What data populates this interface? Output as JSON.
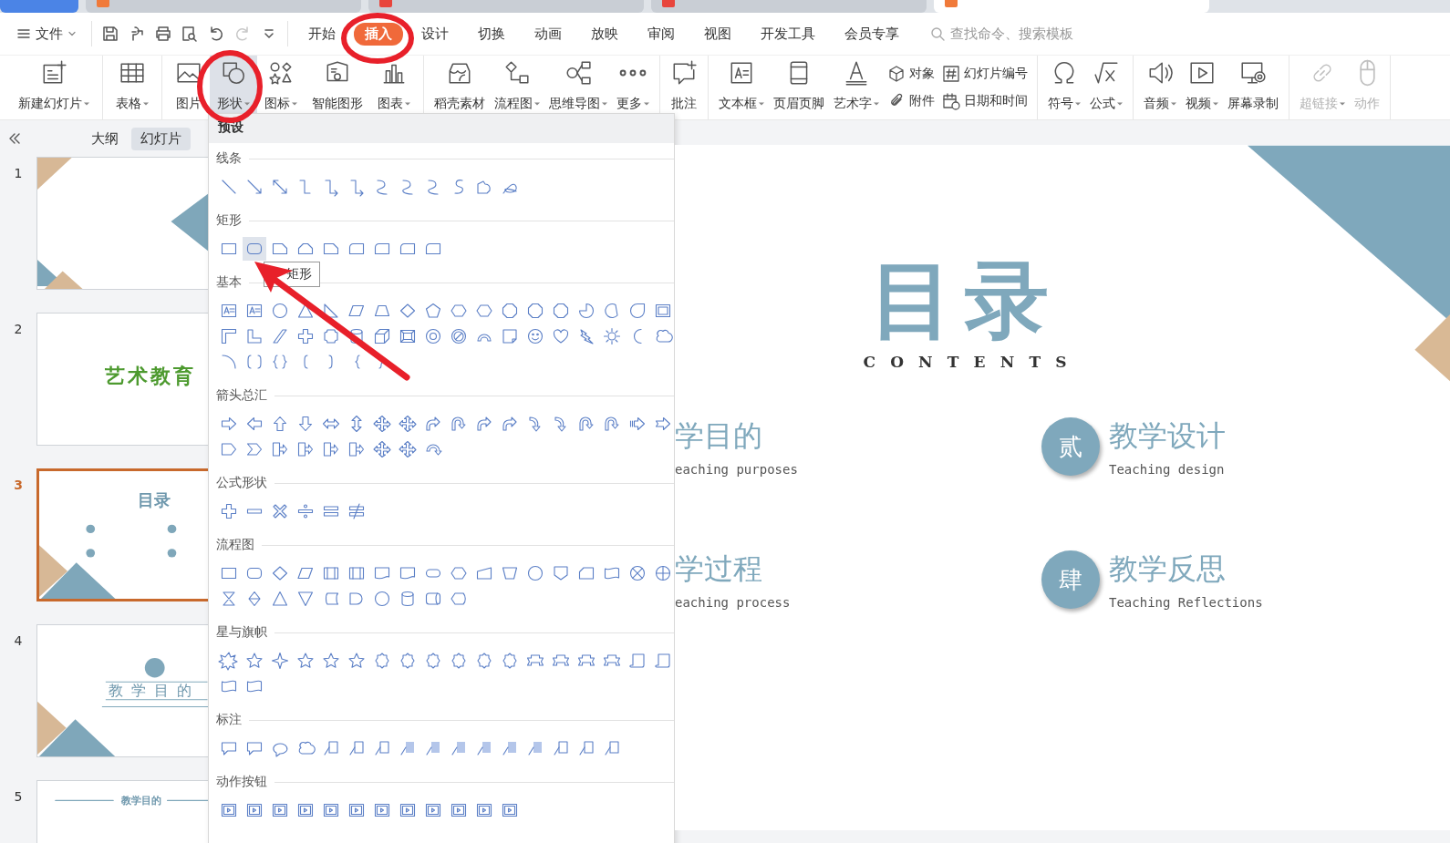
{
  "doc_tabs": [
    {
      "kind": "home",
      "selected": false
    },
    {
      "kind": "doc",
      "selected": false,
      "color": "#f07a3a"
    },
    {
      "kind": "doc",
      "selected": false,
      "color": "#e8453c"
    },
    {
      "kind": "doc",
      "selected": false,
      "color": "#e8453c"
    },
    {
      "kind": "doc",
      "selected": true,
      "color": "#f07a3a"
    }
  ],
  "menu": {
    "file": "文件",
    "tabs": [
      {
        "label": "开始",
        "selected": false
      },
      {
        "label": "插入",
        "selected": true
      },
      {
        "label": "设计",
        "selected": false
      },
      {
        "label": "切换",
        "selected": false
      },
      {
        "label": "动画",
        "selected": false
      },
      {
        "label": "放映",
        "selected": false
      },
      {
        "label": "审阅",
        "selected": false
      },
      {
        "label": "视图",
        "selected": false
      },
      {
        "label": "开发工具",
        "selected": false
      },
      {
        "label": "会员专享",
        "selected": false
      }
    ],
    "search": {
      "placeholder": "查找命令、搜索模板"
    }
  },
  "ribbon": [
    {
      "items": [
        {
          "kind": "large",
          "label": "新建幻灯片",
          "dropdown": true,
          "selected": false,
          "disabled": false
        }
      ]
    },
    {
      "items": [
        {
          "kind": "large",
          "label": "表格",
          "dropdown": true,
          "selected": false,
          "disabled": false
        }
      ]
    },
    {
      "items": [
        {
          "kind": "large",
          "label": "图片",
          "dropdown": false,
          "selected": false,
          "disabled": false
        },
        {
          "kind": "large",
          "label": "形状",
          "dropdown": true,
          "selected": true,
          "disabled": false
        },
        {
          "kind": "large",
          "label": "图标",
          "dropdown": true,
          "selected": false,
          "disabled": false
        },
        {
          "kind": "large",
          "label": "智能图形",
          "dropdown": false,
          "selected": false,
          "disabled": false
        },
        {
          "kind": "large",
          "label": "图表",
          "dropdown": true,
          "selected": false,
          "disabled": false
        }
      ]
    },
    {
      "items": [
        {
          "kind": "large",
          "label": "稻壳素材",
          "dropdown": false,
          "selected": false,
          "disabled": false
        },
        {
          "kind": "large",
          "label": "流程图",
          "dropdown": true,
          "selected": false,
          "disabled": false
        },
        {
          "kind": "large",
          "label": "思维导图",
          "dropdown": true,
          "selected": false,
          "disabled": false
        },
        {
          "kind": "large",
          "label": "更多",
          "dropdown": true,
          "selected": false,
          "disabled": false
        }
      ]
    },
    {
      "items": [
        {
          "kind": "large",
          "label": "批注",
          "dropdown": false,
          "selected": false,
          "disabled": false
        }
      ]
    },
    {
      "items": [
        {
          "kind": "large",
          "label": "文本框",
          "dropdown": true,
          "selected": false,
          "disabled": false
        },
        {
          "kind": "large",
          "label": "页眉页脚",
          "dropdown": false,
          "selected": false,
          "disabled": false
        },
        {
          "kind": "large",
          "label": "艺术字",
          "dropdown": true,
          "selected": false,
          "disabled": false
        },
        {
          "kind": "stack",
          "items": [
            {
              "label": "对象"
            },
            {
              "label": "附件"
            }
          ]
        },
        {
          "kind": "stack",
          "items": [
            {
              "label": "幻灯片编号"
            },
            {
              "label": "日期和时间"
            }
          ]
        }
      ]
    },
    {
      "items": [
        {
          "kind": "large",
          "label": "符号",
          "dropdown": true,
          "selected": false,
          "disabled": false
        },
        {
          "kind": "large",
          "label": "公式",
          "dropdown": true,
          "selected": false,
          "disabled": false
        }
      ]
    },
    {
      "items": [
        {
          "kind": "large",
          "label": "音频",
          "dropdown": true,
          "selected": false,
          "disabled": false
        },
        {
          "kind": "large",
          "label": "视频",
          "dropdown": true,
          "selected": false,
          "disabled": false
        },
        {
          "kind": "large",
          "label": "屏幕录制",
          "dropdown": false,
          "selected": false,
          "disabled": false
        }
      ]
    },
    {
      "items": [
        {
          "kind": "large",
          "label": "超链接",
          "dropdown": true,
          "selected": false,
          "disabled": true
        },
        {
          "kind": "large",
          "label": "动作",
          "dropdown": false,
          "selected": false,
          "disabled": true
        }
      ]
    }
  ],
  "sidebar": {
    "tabs": [
      {
        "label": "大纲",
        "selected": false
      },
      {
        "label": "幻灯片",
        "selected": true
      }
    ],
    "slides": [
      {
        "number": "1",
        "kind": "cover",
        "selected": false
      },
      {
        "number": "2",
        "kind": "title",
        "text": "艺术教育",
        "selected": false
      },
      {
        "number": "3",
        "kind": "contents",
        "text": "目录",
        "selected": true
      },
      {
        "number": "4",
        "kind": "section",
        "text": "教 学 目 的",
        "selected": false
      },
      {
        "number": "5",
        "kind": "content",
        "text": "教学目的",
        "selected": false
      }
    ]
  },
  "shapes_menu": {
    "header": "预设",
    "tooltip": "矩形",
    "sections": [
      {
        "title": "线条",
        "shapes": [
          {
            "kind": "line",
            "hovered": false
          },
          {
            "kind": "arrowline",
            "hovered": false
          },
          {
            "kind": "dblline",
            "hovered": false
          },
          {
            "kind": "elbow",
            "hovered": false
          },
          {
            "kind": "elbowarrow",
            "hovered": false
          },
          {
            "kind": "elbowarrow",
            "hovered": false
          },
          {
            "kind": "curve",
            "hovered": false
          },
          {
            "kind": "curve",
            "hovered": false
          },
          {
            "kind": "curve",
            "hovered": false
          },
          {
            "kind": "scurve",
            "hovered": false
          },
          {
            "kind": "freeform",
            "hovered": false
          },
          {
            "kind": "scribble",
            "hovered": false
          }
        ]
      },
      {
        "title": "矩形",
        "shapes": [
          {
            "kind": "rect",
            "hovered": false
          },
          {
            "kind": "rrect",
            "hovered": true
          },
          {
            "kind": "snip",
            "hovered": false
          },
          {
            "kind": "snip2",
            "hovered": false
          },
          {
            "kind": "snip",
            "hovered": false
          },
          {
            "kind": "roundtop",
            "hovered": false
          },
          {
            "kind": "roundtop",
            "hovered": false
          },
          {
            "kind": "roundtop",
            "hovered": false
          },
          {
            "kind": "roundtop",
            "hovered": false
          }
        ]
      },
      {
        "title": "基本",
        "shapes": [
          {
            "kind": "textbox",
            "hovered": false
          },
          {
            "kind": "textbox",
            "hovered": false
          },
          {
            "kind": "circle",
            "hovered": false
          },
          {
            "kind": "tri",
            "hovered": false
          },
          {
            "kind": "rtri",
            "hovered": false
          },
          {
            "kind": "para",
            "hovered": false
          },
          {
            "kind": "trap",
            "hovered": false
          },
          {
            "kind": "diamond",
            "hovered": false
          },
          {
            "kind": "pent",
            "hovered": false
          },
          {
            "kind": "hex",
            "hovered": false
          },
          {
            "kind": "hex",
            "hovered": false
          },
          {
            "kind": "oct",
            "hovered": false
          },
          {
            "kind": "oct",
            "hovered": false
          },
          {
            "kind": "oct",
            "hovered": false
          },
          {
            "kind": "pie",
            "hovered": false
          },
          {
            "kind": "chord",
            "hovered": false
          },
          {
            "kind": "tear",
            "hovered": false
          },
          {
            "kind": "frame",
            "hovered": false
          },
          {
            "kind": "corner",
            "hovered": false
          },
          {
            "kind": "lshape",
            "hovered": false
          },
          {
            "kind": "diag",
            "hovered": false
          },
          {
            "kind": "plus",
            "hovered": false
          },
          {
            "kind": "plaque",
            "hovered": false
          },
          {
            "kind": "can",
            "hovered": false
          },
          {
            "kind": "cube",
            "hovered": false
          },
          {
            "kind": "bevel",
            "hovered": false
          },
          {
            "kind": "donut",
            "hovered": false
          },
          {
            "kind": "nosym",
            "hovered": false
          },
          {
            "kind": "arc",
            "hovered": false
          },
          {
            "kind": "fold",
            "hovered": false
          },
          {
            "kind": "smile",
            "hovered": false
          },
          {
            "kind": "heart",
            "hovered": false
          },
          {
            "kind": "bolt",
            "hovered": false
          },
          {
            "kind": "sun",
            "hovered": false
          },
          {
            "kind": "moon",
            "hovered": false
          },
          {
            "kind": "cloud",
            "hovered": false
          },
          {
            "kind": "quarc",
            "hovered": false
          },
          {
            "kind": "bracketpair",
            "hovered": false
          },
          {
            "kind": "bracepair",
            "hovered": false
          },
          {
            "kind": "lbracket",
            "hovered": false
          },
          {
            "kind": "rbracket",
            "hovered": false
          },
          {
            "kind": "lbrace",
            "hovered": false
          },
          {
            "kind": "rbrace",
            "hovered": false
          }
        ]
      },
      {
        "title": "箭头总汇",
        "shapes": [
          {
            "kind": "rarrow",
            "hovered": false
          },
          {
            "kind": "larrow",
            "hovered": false
          },
          {
            "kind": "uarrow",
            "hovered": false
          },
          {
            "kind": "darrow",
            "hovered": false
          },
          {
            "kind": "lrarrow",
            "hovered": false
          },
          {
            "kind": "udarrow",
            "hovered": false
          },
          {
            "kind": "quadarrow",
            "hovered": false
          },
          {
            "kind": "quadarrow",
            "hovered": false
          },
          {
            "kind": "bent",
            "hovered": false
          },
          {
            "kind": "uturn",
            "hovered": false
          },
          {
            "kind": "bent",
            "hovered": false
          },
          {
            "kind": "bent",
            "hovered": false
          },
          {
            "kind": "curvedarrow",
            "hovered": false
          },
          {
            "kind": "curvedarrow",
            "hovered": false
          },
          {
            "kind": "uturn",
            "hovered": false
          },
          {
            "kind": "uturn",
            "hovered": false
          },
          {
            "kind": "striped",
            "hovered": false
          },
          {
            "kind": "notched",
            "hovered": false
          },
          {
            "kind": "pentarrow",
            "hovered": false
          },
          {
            "kind": "chevron",
            "hovered": false
          },
          {
            "kind": "calloutarrow",
            "hovered": false
          },
          {
            "kind": "calloutarrow",
            "hovered": false
          },
          {
            "kind": "calloutarrow",
            "hovered": false
          },
          {
            "kind": "calloutarrow",
            "hovered": false
          },
          {
            "kind": "quadarrow",
            "hovered": false
          },
          {
            "kind": "quadarrow",
            "hovered": false
          },
          {
            "kind": "circarrow",
            "hovered": false
          }
        ]
      },
      {
        "title": "公式形状",
        "shapes": [
          {
            "kind": "plus",
            "hovered": false
          },
          {
            "kind": "minus",
            "hovered": false
          },
          {
            "kind": "times",
            "hovered": false
          },
          {
            "kind": "divide",
            "hovered": false
          },
          {
            "kind": "equal",
            "hovered": false
          },
          {
            "kind": "neq",
            "hovered": false
          }
        ]
      },
      {
        "title": "流程图",
        "shapes": [
          {
            "kind": "rect",
            "hovered": false
          },
          {
            "kind": "rrect",
            "hovered": false
          },
          {
            "kind": "diamond",
            "hovered": false
          },
          {
            "kind": "para",
            "hovered": false
          },
          {
            "kind": "predef",
            "hovered": false
          },
          {
            "kind": "predef",
            "hovered": false
          },
          {
            "kind": "doc",
            "hovered": false
          },
          {
            "kind": "doc",
            "hovered": false
          },
          {
            "kind": "terminator",
            "hovered": false
          },
          {
            "kind": "hex",
            "hovered": false
          },
          {
            "kind": "manual",
            "hovered": false
          },
          {
            "kind": "invtrap",
            "hovered": false
          },
          {
            "kind": "circle",
            "hovered": false
          },
          {
            "kind": "offpage",
            "hovered": false
          },
          {
            "kind": "card",
            "hovered": false
          },
          {
            "kind": "tape",
            "hovered": false
          },
          {
            "kind": "xcircle",
            "hovered": false
          },
          {
            "kind": "pluscircle",
            "hovered": false
          },
          {
            "kind": "hourglass",
            "hovered": false
          },
          {
            "kind": "sort",
            "hovered": false
          },
          {
            "kind": "tri",
            "hovered": false
          },
          {
            "kind": "invtri",
            "hovered": false
          },
          {
            "kind": "stored",
            "hovered": false
          },
          {
            "kind": "delay",
            "hovered": false
          },
          {
            "kind": "circle",
            "hovered": false
          },
          {
            "kind": "can",
            "hovered": false
          },
          {
            "kind": "hcan",
            "hovered": false
          },
          {
            "kind": "display",
            "hovered": false
          }
        ]
      },
      {
        "title": "星与旗帜",
        "shapes": [
          {
            "kind": "burst",
            "hovered": false
          },
          {
            "kind": "star5",
            "hovered": false
          },
          {
            "kind": "star4",
            "hovered": false
          },
          {
            "kind": "star5",
            "hovered": false
          },
          {
            "kind": "star5",
            "hovered": false
          },
          {
            "kind": "star5",
            "hovered": false
          },
          {
            "kind": "seal",
            "hovered": false
          },
          {
            "kind": "seal",
            "hovered": false
          },
          {
            "kind": "seal",
            "hovered": false
          },
          {
            "kind": "seal",
            "hovered": false
          },
          {
            "kind": "seal",
            "hovered": false
          },
          {
            "kind": "seal",
            "hovered": false
          },
          {
            "kind": "ribbon",
            "hovered": false
          },
          {
            "kind": "ribbon",
            "hovered": false
          },
          {
            "kind": "ribbon",
            "hovered": false
          },
          {
            "kind": "ribbon",
            "hovered": false
          },
          {
            "kind": "scroll",
            "hovered": false
          },
          {
            "kind": "scroll",
            "hovered": false
          },
          {
            "kind": "wave",
            "hovered": false
          },
          {
            "kind": "wave",
            "hovered": false
          }
        ]
      },
      {
        "title": "标注",
        "shapes": [
          {
            "kind": "rectcallout",
            "hovered": false
          },
          {
            "kind": "rectcallout",
            "hovered": false
          },
          {
            "kind": "ovalcallout",
            "hovered": false
          },
          {
            "kind": "cloud",
            "hovered": false
          },
          {
            "kind": "linecallout",
            "hovered": false
          },
          {
            "kind": "linecallout",
            "hovered": false
          },
          {
            "kind": "linecallout",
            "hovered": false
          },
          {
            "kind": "fillcallout",
            "hovered": false
          },
          {
            "kind": "fillcallout",
            "hovered": false
          },
          {
            "kind": "fillcallout",
            "hovered": false
          },
          {
            "kind": "fillcallout",
            "hovered": false
          },
          {
            "kind": "fillcallout",
            "hovered": false
          },
          {
            "kind": "fillcallout",
            "hovered": false
          },
          {
            "kind": "linecallout",
            "hovered": false
          },
          {
            "kind": "linecallout",
            "hovered": false
          },
          {
            "kind": "linecallout",
            "hovered": false
          }
        ]
      },
      {
        "title": "动作按钮",
        "shapes": [
          {
            "kind": "action",
            "hovered": false
          },
          {
            "kind": "action",
            "hovered": false
          },
          {
            "kind": "action",
            "hovered": false
          },
          {
            "kind": "action",
            "hovered": false
          },
          {
            "kind": "action",
            "hovered": false
          },
          {
            "kind": "action",
            "hovered": false
          },
          {
            "kind": "action",
            "hovered": false
          },
          {
            "kind": "action",
            "hovered": false
          },
          {
            "kind": "action",
            "hovered": false
          },
          {
            "kind": "action",
            "hovered": false
          },
          {
            "kind": "action",
            "hovered": false
          },
          {
            "kind": "action",
            "hovered": false
          }
        ]
      }
    ]
  },
  "slide": {
    "title": "目录",
    "subtitle": "CONTENTS",
    "items": [
      {
        "title": "学目的",
        "english": "eaching purposes"
      },
      {
        "title": "教学设计",
        "english": "Teaching design",
        "badge": "贰"
      },
      {
        "title": "学过程",
        "english": "eaching process"
      },
      {
        "title": "教学反思",
        "english": "Teaching Reflections",
        "badge": "肆"
      }
    ]
  }
}
